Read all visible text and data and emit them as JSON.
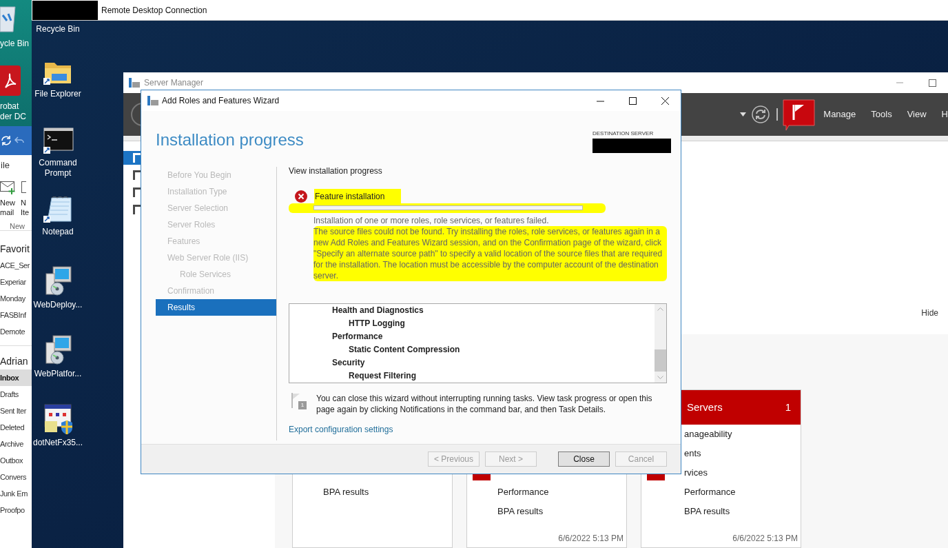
{
  "local_desktop": {
    "icons": [
      {
        "kind": "recycle-bin",
        "lines": [
          "ycle Bin"
        ]
      },
      {
        "kind": "pdf",
        "lines": [
          "robat",
          "der DC"
        ]
      }
    ]
  },
  "outlook": {
    "tab": "ile",
    "ribbon_buttons": [
      {
        "kind": "new-mail",
        "lines": [
          "New",
          "mail"
        ]
      },
      {
        "kind": "new-item",
        "lines": [
          "N",
          "Ite"
        ]
      }
    ],
    "group_label": "New",
    "favorites_header": "Favorit",
    "favorites": [
      "ACE_Ser",
      "Experiar",
      "Monday",
      "FASBInf",
      "Demote"
    ],
    "account": "Adrian",
    "folders": [
      {
        "label": "Inbox",
        "selected": true
      },
      {
        "label": "Drafts",
        "selected": false
      },
      {
        "label": "Sent Iter",
        "selected": false
      },
      {
        "label": "Deleted",
        "selected": false
      },
      {
        "label": "Archive",
        "selected": false
      },
      {
        "label": "Outbox",
        "selected": false
      },
      {
        "label": "Convers",
        "selected": false
      },
      {
        "label": "Junk Em",
        "selected": false
      },
      {
        "label": "Proofpo",
        "selected": false
      }
    ]
  },
  "remote_desktop": {
    "title": "Remote Desktop Connection",
    "desktop_icons": [
      {
        "kind": "label-only",
        "lines": [
          "Recycle Bin"
        ]
      },
      {
        "kind": "folder",
        "lines": [
          "File Explorer"
        ]
      },
      {
        "kind": "terminal",
        "lines": [
          "Command",
          "Prompt"
        ]
      },
      {
        "kind": "notepad",
        "lines": [
          "Notepad"
        ]
      },
      {
        "kind": "installer",
        "lines": [
          "WebDeploy..."
        ]
      },
      {
        "kind": "installer",
        "lines": [
          "WebPlatfor..."
        ]
      },
      {
        "kind": "setup",
        "lines": [
          "dotNetFx35..."
        ]
      }
    ]
  },
  "server_manager": {
    "title": "Server Manager",
    "nav": [
      {
        "selected": true
      },
      {
        "selected": false
      },
      {
        "selected": false
      },
      {
        "selected": false
      }
    ],
    "menu": [
      "Manage",
      "Tools",
      "View",
      "H"
    ],
    "hide_link": "Hide",
    "cards": [
      {
        "alert": false,
        "rows": [
          "BPA results"
        ]
      },
      {
        "alert": true,
        "rows": [
          "Performance",
          "BPA results"
        ],
        "timestamp": "6/6/2022 5:13 PM"
      },
      {
        "title": "Servers",
        "count": "1",
        "alert": true,
        "rows": [
          "anageability",
          "ents",
          "rvices",
          "Performance",
          "BPA results"
        ],
        "timestamp": "6/6/2022 5:13 PM"
      }
    ]
  },
  "wizard": {
    "title": "Add Roles and Features Wizard",
    "heading": "Installation progress",
    "destination_label": "DESTINATION SERVER",
    "steps": [
      {
        "label": "Before You Begin",
        "selected": false
      },
      {
        "label": "Installation Type",
        "selected": false
      },
      {
        "label": "Server Selection",
        "selected": false
      },
      {
        "label": "Server Roles",
        "selected": false
      },
      {
        "label": "Features",
        "selected": false
      },
      {
        "label": "Web Server Role (IIS)",
        "selected": false,
        "children": [
          {
            "label": "Role Services",
            "selected": false
          }
        ]
      },
      {
        "label": "Confirmation",
        "selected": false
      },
      {
        "label": "Results",
        "selected": true
      }
    ],
    "section_title": "View installation progress",
    "task": {
      "name": "Feature installation",
      "failed": true,
      "level": 0,
      "summary": "Installation of one or more roles, role services, or features failed.",
      "detail": "The source files could not be found. Try installing the roles, role services, or features again in a new Add Roles and Features Wizard session, and on the Confirmation page of the wizard, click \"Specify an alternate source path\" to specify a valid location of the source files that are required for the installation. The location must be accessible by the computer account of the destination server."
    },
    "results": [
      {
        "label": "Health and Diagnostics",
        "children": [
          {
            "label": "HTTP Logging"
          }
        ]
      },
      {
        "label": "Performance",
        "children": [
          {
            "label": "Static Content Compression"
          }
        ]
      },
      {
        "label": "Security",
        "children": [
          {
            "label": "Request Filtering"
          }
        ]
      }
    ],
    "note_badge": "1",
    "note": "You can close this wizard without interrupting running tasks. View task progress or open this page again by clicking Notifications in the command bar, and then Task Details.",
    "export_link": "Export configuration settings",
    "buttons": [
      {
        "label": "< Previous",
        "disabled": true,
        "default": false
      },
      {
        "label": "Next >",
        "disabled": true,
        "default": false
      },
      {
        "label": "Close",
        "disabled": false,
        "default": true
      },
      {
        "label": "Cancel",
        "disabled": true,
        "default": false
      }
    ]
  }
}
